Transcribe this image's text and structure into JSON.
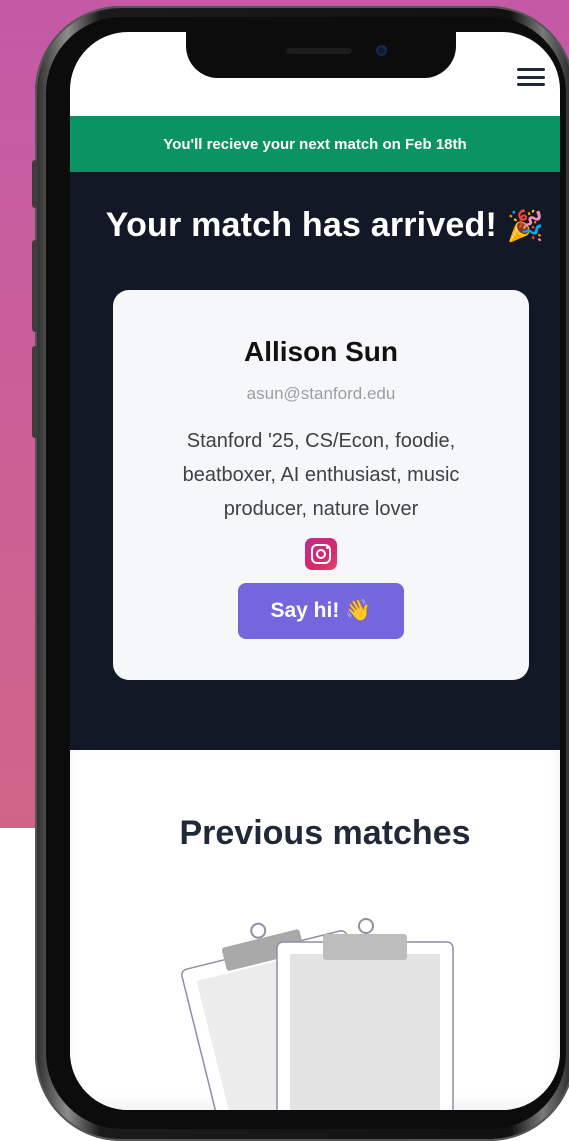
{
  "screen": {
    "banner_text": "You'll recieve your next match on Feb 18th",
    "headline": "Your match has arrived!",
    "headline_icon": "🎉",
    "match_card": {
      "name": "Allison Sun",
      "email": "asun@stanford.edu",
      "bio": "Stanford '25, CS/Econ, foodie, beatboxer, AI enthusiast, music producer, nature lover",
      "social_icon": "instagram-icon",
      "say_hi_label": "Say hi!",
      "say_hi_icon": "👋"
    },
    "previous_title": "Previous matches"
  },
  "colors": {
    "banner": "#0b9363",
    "match_section": "#121826",
    "button": "#7466dc",
    "backdrop": "#c85e98",
    "instagram": "#d6286e"
  }
}
